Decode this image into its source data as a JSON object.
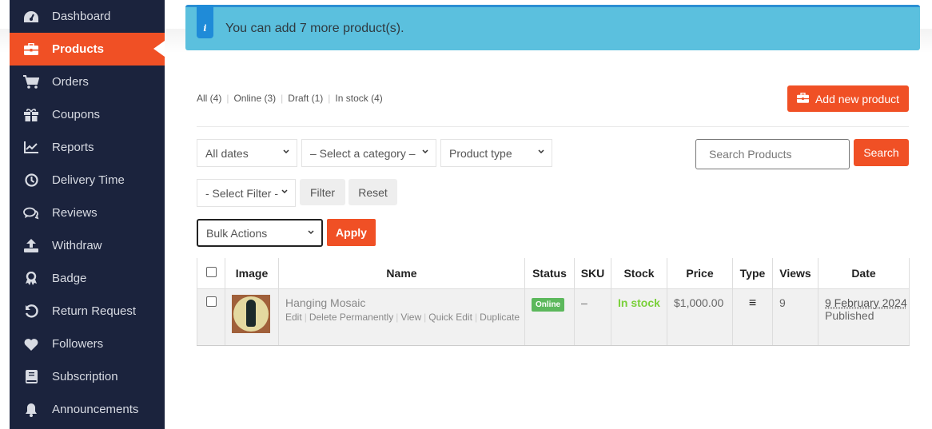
{
  "sidebar": {
    "items": [
      {
        "label": "Dashboard",
        "icon": "dashboard-icon",
        "active": false
      },
      {
        "label": "Products",
        "icon": "briefcase-icon",
        "active": true
      },
      {
        "label": "Orders",
        "icon": "cart-icon",
        "active": false
      },
      {
        "label": "Coupons",
        "icon": "gift-icon",
        "active": false
      },
      {
        "label": "Reports",
        "icon": "chart-icon",
        "active": false
      },
      {
        "label": "Delivery Time",
        "icon": "clock-icon",
        "active": false
      },
      {
        "label": "Reviews",
        "icon": "comments-icon",
        "active": false
      },
      {
        "label": "Withdraw",
        "icon": "upload-icon",
        "active": false
      },
      {
        "label": "Badge",
        "icon": "award-icon",
        "active": false
      },
      {
        "label": "Return Request",
        "icon": "undo-icon",
        "active": false
      },
      {
        "label": "Followers",
        "icon": "heart-icon",
        "active": false
      },
      {
        "label": "Subscription",
        "icon": "book-icon",
        "active": false
      },
      {
        "label": "Announcements",
        "icon": "bell-icon",
        "active": false
      }
    ]
  },
  "alert": {
    "icon": "i",
    "message": "You can add 7 more product(s)."
  },
  "status_filters": [
    {
      "label": "All (4)"
    },
    {
      "label": "Online (3)"
    },
    {
      "label": "Draft (1)"
    },
    {
      "label": "In stock (4)"
    }
  ],
  "add_button": {
    "label": "Add new product"
  },
  "filters": {
    "dates": "All dates",
    "category": "– Select a category –",
    "product_type": "Product type",
    "select_filter": "- Select Filter -",
    "filter_label": "Filter",
    "reset_label": "Reset"
  },
  "search": {
    "placeholder": "Search Products",
    "button_label": "Search"
  },
  "bulk": {
    "selected": "Bulk Actions",
    "apply_label": "Apply"
  },
  "table": {
    "headers": [
      "Image",
      "Name",
      "Status",
      "SKU",
      "Stock",
      "Price",
      "Type",
      "Views",
      "Date"
    ],
    "rows": [
      {
        "name": "Hanging Mosaic",
        "actions": [
          "Edit",
          "Delete Permanently",
          "View",
          "Quick Edit",
          "Duplicate"
        ],
        "status": "Online",
        "sku": "–",
        "stock": "In stock",
        "price": "$1,000.00",
        "type_icon": "≡",
        "views": "9",
        "date": "9 February 2024",
        "date_status": "Published"
      }
    ]
  },
  "colors": {
    "accent": "#f05025",
    "sidebar_bg": "#1b233d",
    "alert_bg": "#5bc0de",
    "online_badge": "#5cb85c",
    "in_stock": "#7ad03a"
  }
}
